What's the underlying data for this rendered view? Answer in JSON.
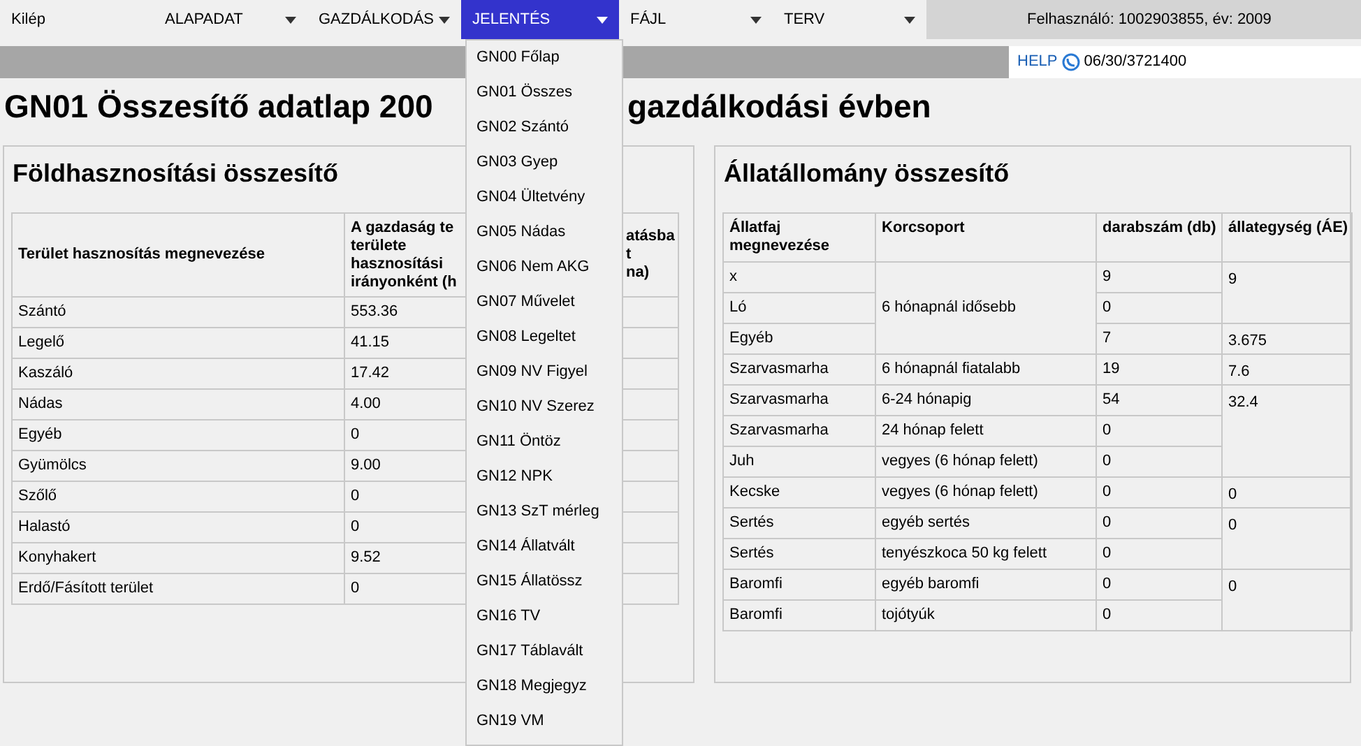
{
  "menu": [
    {
      "label": "Kilép",
      "dropdown": false,
      "selected": false
    },
    {
      "label": "ALAPADAT",
      "dropdown": true,
      "selected": false
    },
    {
      "label": "GAZDÁLKODÁS",
      "dropdown": true,
      "selected": false
    },
    {
      "label": "JELENTÉS",
      "dropdown": true,
      "selected": true
    },
    {
      "label": "FÁJL",
      "dropdown": true,
      "selected": false
    },
    {
      "label": "TERV",
      "dropdown": true,
      "selected": false
    }
  ],
  "user_info": "Felhasználó: 1002903855, év: 2009",
  "help": {
    "link": "HELP",
    "phone": "06/30/3721400"
  },
  "page_title": "GN01 Összesítő adatlap 200",
  "page_title_end": "gazdálkodási évben",
  "land": {
    "title": "Földhasznosítási összesítő",
    "columns": [
      {
        "lines": [
          "Terület hasznosítás megnevezése"
        ]
      },
      {
        "lines": [
          "A gazdaság te",
          "területe",
          "hasznosítási",
          "irányonként (h"
        ]
      },
      {
        "lines": [
          "atásba",
          "t",
          "na)"
        ]
      }
    ],
    "rows": [
      [
        "Szántó",
        "553.36"
      ],
      [
        "Legelő",
        "41.15"
      ],
      [
        "Kaszáló",
        "17.42"
      ],
      [
        "Nádas",
        "4.00"
      ],
      [
        "Egyéb",
        "0"
      ],
      [
        "Gyümölcs",
        "9.00"
      ],
      [
        "Szőlő",
        "0"
      ],
      [
        "Halastó",
        "0"
      ],
      [
        "Konyhakert",
        "9.52"
      ],
      [
        "Erdő/Fásított terület",
        "0"
      ]
    ]
  },
  "livestock": {
    "title": "Állatállomány összesítő",
    "columns": [
      "Állatfaj megnevezése",
      "Korcsoport",
      "darabszám (db)",
      "állategység (ÁE)"
    ],
    "rows": [
      {
        "species": "x",
        "age_group": "6 hónapnál idősebb",
        "count": "9",
        "ae": "9"
      },
      {
        "species": "Ló",
        "count": "0"
      },
      {
        "species": "Egyéb",
        "count": "7",
        "ae": "3.675"
      },
      {
        "species": "Szarvasmarha",
        "age_group": "6 hónapnál fiatalabb",
        "count": "19",
        "ae": "7.6"
      },
      {
        "species": "Szarvasmarha",
        "age_group": "6-24 hónapig",
        "count": "54",
        "ae": "32.4"
      },
      {
        "species": "Szarvasmarha",
        "age_group": "24 hónap felett",
        "count": "0"
      },
      {
        "species": "Juh",
        "age_group": "vegyes (6 hónap felett)",
        "count": "0"
      },
      {
        "species": "Kecske",
        "age_group": "vegyes (6 hónap felett)",
        "count": "0",
        "ae": "0"
      },
      {
        "species": "Sertés",
        "age_group": "egyéb sertés",
        "count": "0",
        "ae": "0"
      },
      {
        "species": "Sertés",
        "age_group": "tenyészkoca 50 kg felett",
        "count": "0"
      },
      {
        "species": "Baromfi",
        "age_group": "egyéb baromfi",
        "count": "0",
        "ae": "0"
      },
      {
        "species": "Baromfi",
        "age_group": "tojótyúk",
        "count": "0"
      }
    ]
  },
  "dropdown": [
    "GN00 Főlap",
    "GN01 Összes",
    "GN02 Szántó",
    "GN03 Gyep",
    "GN04 Ültetvény",
    "GN05 Nádas",
    "GN06 Nem AKG",
    "GN07 Művelet",
    "GN08 Legeltet",
    "GN09 NV Figyel",
    "GN10 NV Szerez",
    "GN11 Öntöz",
    "GN12 NPK",
    "GN13 SzT mérleg",
    "GN14 Állatvált",
    "GN15 Állatössz",
    "GN16 TV",
    "GN17 Táblavált",
    "GN18 Megjegyz",
    "GN19 VM"
  ]
}
